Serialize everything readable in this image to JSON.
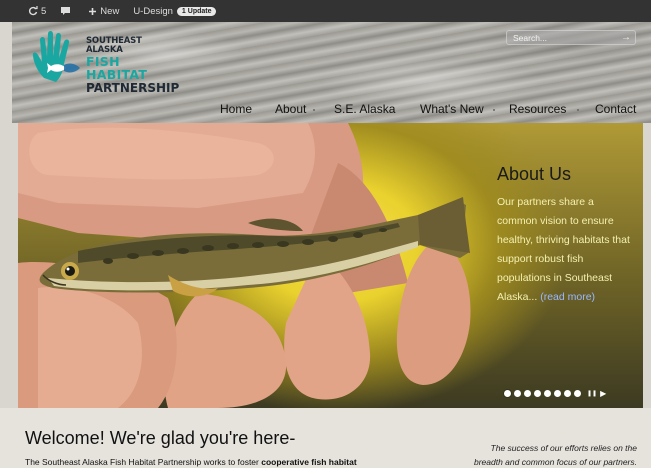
{
  "admin_bar": {
    "updates_count": "5",
    "new_label": "New",
    "site_name": "U-Design",
    "update_badge": "1 Update",
    "icons": [
      "refresh-icon",
      "comment-icon",
      "plus-icon"
    ]
  },
  "logo": {
    "line1": "SOUTHEAST ALASKA",
    "line2": "FISH HABITAT",
    "line3": "PARTNERSHIP",
    "icon": "hand-icon"
  },
  "search": {
    "placeholder": "Search...",
    "icon": "arrow-right-icon"
  },
  "nav": {
    "items": [
      {
        "label": "Home"
      },
      {
        "label": "About"
      },
      {
        "label": "S.E. Alaska"
      },
      {
        "label": "What's New"
      },
      {
        "label": "Resources"
      },
      {
        "label": "Contact"
      }
    ]
  },
  "slider": {
    "title": "About Us",
    "body": "Our partners share a common vision to ensure healthy, thriving habitats that support robust fish populations in Southeast Alaska...",
    "read_more": "(read more)",
    "slide_count": 8,
    "active_slide": 1,
    "controls": [
      "pause-icon",
      "play-icon"
    ]
  },
  "content": {
    "heading": "Welcome! We're glad you're here-",
    "intro_start": "The Southeast Alaska Fish Habitat Partnership works to foster ",
    "intro_bold": "cooperative fish habitat",
    "quote_line1": "The success of our efforts relies on the",
    "quote_line2": "breadth and common focus of our partners."
  },
  "colors": {
    "admin_bar": "#333333",
    "accent_teal": "#1aa7a2",
    "caption_text": "#f4f0b0",
    "read_more_link": "#9ab8ff"
  }
}
